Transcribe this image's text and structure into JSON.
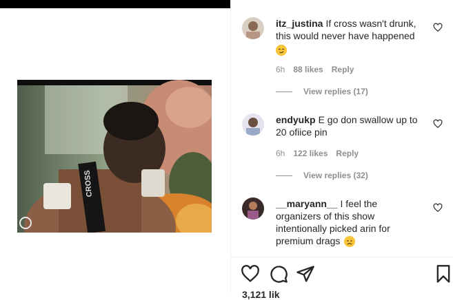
{
  "post": {
    "likes_partial": "3,121 lik"
  },
  "video": {
    "shirt_text": "CROSS"
  },
  "comments": [
    {
      "username": "itz_justina",
      "text": "If cross wasn't drunk, this would never have happened",
      "emoji": "smirk-face",
      "time": "6h",
      "likes": "88 likes",
      "reply": "Reply",
      "view_replies": "View replies (17)"
    },
    {
      "username": "endyukp",
      "text": "E go don swallow up to 20 ofiice pin",
      "time": "6h",
      "likes": "122 likes",
      "reply": "Reply",
      "view_replies": "View replies (32)"
    },
    {
      "username": "__maryann__",
      "text": "I feel the organizers of this show intentionally picked arin for premium drags",
      "emoji": "disappointed-face"
    }
  ],
  "colors": {
    "text": "#262626",
    "muted": "#8e8e8e",
    "divider": "#efefef"
  }
}
